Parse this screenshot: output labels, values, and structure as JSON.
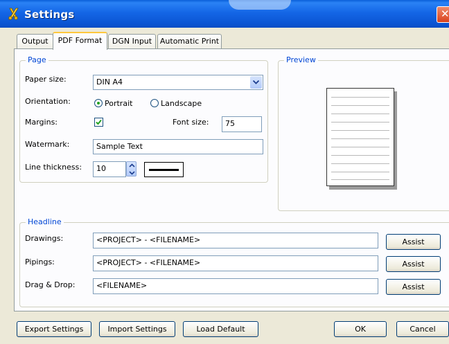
{
  "window": {
    "title": "Settings"
  },
  "tabs": [
    {
      "label": "Output"
    },
    {
      "label": "PDF Format"
    },
    {
      "label": "DGN Input"
    },
    {
      "label": "Automatic Print"
    }
  ],
  "page_group": {
    "legend": "Page",
    "paper_size": {
      "label": "Paper size:",
      "value": "DIN A4"
    },
    "orientation": {
      "label": "Orientation:",
      "options": [
        "Portrait",
        "Landscape"
      ],
      "selected": "Portrait"
    },
    "margins": {
      "label": "Margins:",
      "checked": true
    },
    "font_size": {
      "label": "Font size:",
      "value": "75"
    },
    "watermark": {
      "label": "Watermark:",
      "value": "Sample Text"
    },
    "line_thickness": {
      "label": "Line thickness:",
      "value": "10"
    }
  },
  "preview_group": {
    "legend": "Preview"
  },
  "headline_group": {
    "legend": "Headline",
    "rows": [
      {
        "label": "Drawings:",
        "value": "<PROJECT> - <FILENAME>",
        "button": "Assist"
      },
      {
        "label": "Pipings:",
        "value": "<PROJECT> - <FILENAME>",
        "button": "Assist"
      },
      {
        "label": "Drag & Drop:",
        "value": "<FILENAME>",
        "button": "Assist"
      }
    ]
  },
  "footer": {
    "export_label": "Export Settings",
    "import_label": "Import Settings",
    "load_default_label": "Load Default",
    "ok_label": "OK",
    "cancel_label": "Cancel"
  },
  "colors": {
    "titlebar": "#1466e6",
    "legend_text": "#0046d5",
    "dialog_bg": "#ece9d8",
    "tab_highlight": "#ffc83c"
  },
  "icons": [
    "app-icon",
    "close-icon",
    "chevron-down-icon",
    "spinner-up-icon",
    "spinner-down-icon",
    "checkmark-icon"
  ]
}
